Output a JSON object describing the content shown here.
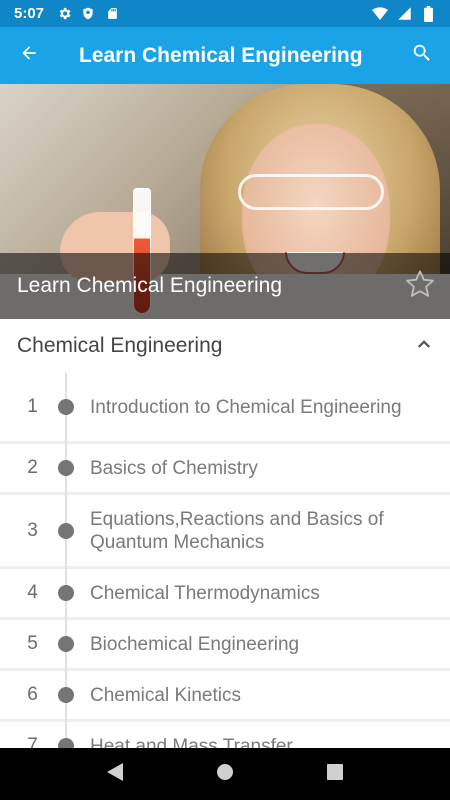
{
  "status_bar": {
    "time": "5:07",
    "left_icons": [
      "gear-icon",
      "shield-icon",
      "sd-card-icon"
    ],
    "right_icons": [
      "wifi-icon",
      "signal-icon",
      "battery-icon"
    ]
  },
  "app_bar": {
    "title": "Learn Chemical Engineering",
    "back_icon": "arrow-left-icon",
    "search_icon": "search-icon",
    "color": "#1aa3e6"
  },
  "hero": {
    "caption": "Learn Chemical Engineering",
    "favorite_icon": "star-outline-icon"
  },
  "section": {
    "title": "Chemical Engineering",
    "toggle_icon": "chevron-up-icon"
  },
  "lessons": [
    {
      "number": "1",
      "title": "Introduction to Chemical Engineering"
    },
    {
      "number": "2",
      "title": "Basics of Chemistry"
    },
    {
      "number": "3",
      "title": "Equations,Reactions and Basics of Quantum Mechanics"
    },
    {
      "number": "4",
      "title": "Chemical Thermodynamics"
    },
    {
      "number": "5",
      "title": "Biochemical Engineering"
    },
    {
      "number": "6",
      "title": "Chemical Kinetics"
    },
    {
      "number": "7",
      "title": "Heat and Mass Transfer"
    }
  ],
  "nav_bar": {
    "icons": [
      "back-triangle-icon",
      "home-circle-icon",
      "recents-square-icon"
    ]
  }
}
